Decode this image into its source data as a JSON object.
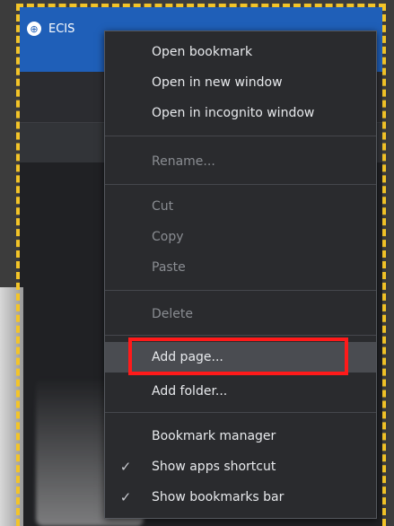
{
  "tab": {
    "title": "ECIS",
    "icon": "globe-icon"
  },
  "menu": {
    "items": [
      {
        "label": "Open bookmark"
      },
      {
        "label": "Open in new window"
      },
      {
        "label": "Open in incognito window"
      },
      {
        "label": "Rename..."
      },
      {
        "label": "Cut"
      },
      {
        "label": "Copy"
      },
      {
        "label": "Paste"
      },
      {
        "label": "Delete"
      },
      {
        "label": "Add page..."
      },
      {
        "label": "Add folder..."
      },
      {
        "label": "Bookmark manager"
      },
      {
        "label": "Show apps shortcut",
        "checked": true
      },
      {
        "label": "Show bookmarks bar",
        "checked": true
      }
    ],
    "check_glyph": "✓",
    "colors": {
      "text": "#e8eaed",
      "disabled": "#8a8d92",
      "background": "#2a2b2e",
      "hover": "#4a4c51"
    }
  },
  "highlight": {
    "color": "#ff1a1a"
  },
  "frame": {
    "color": "#f3c428"
  }
}
